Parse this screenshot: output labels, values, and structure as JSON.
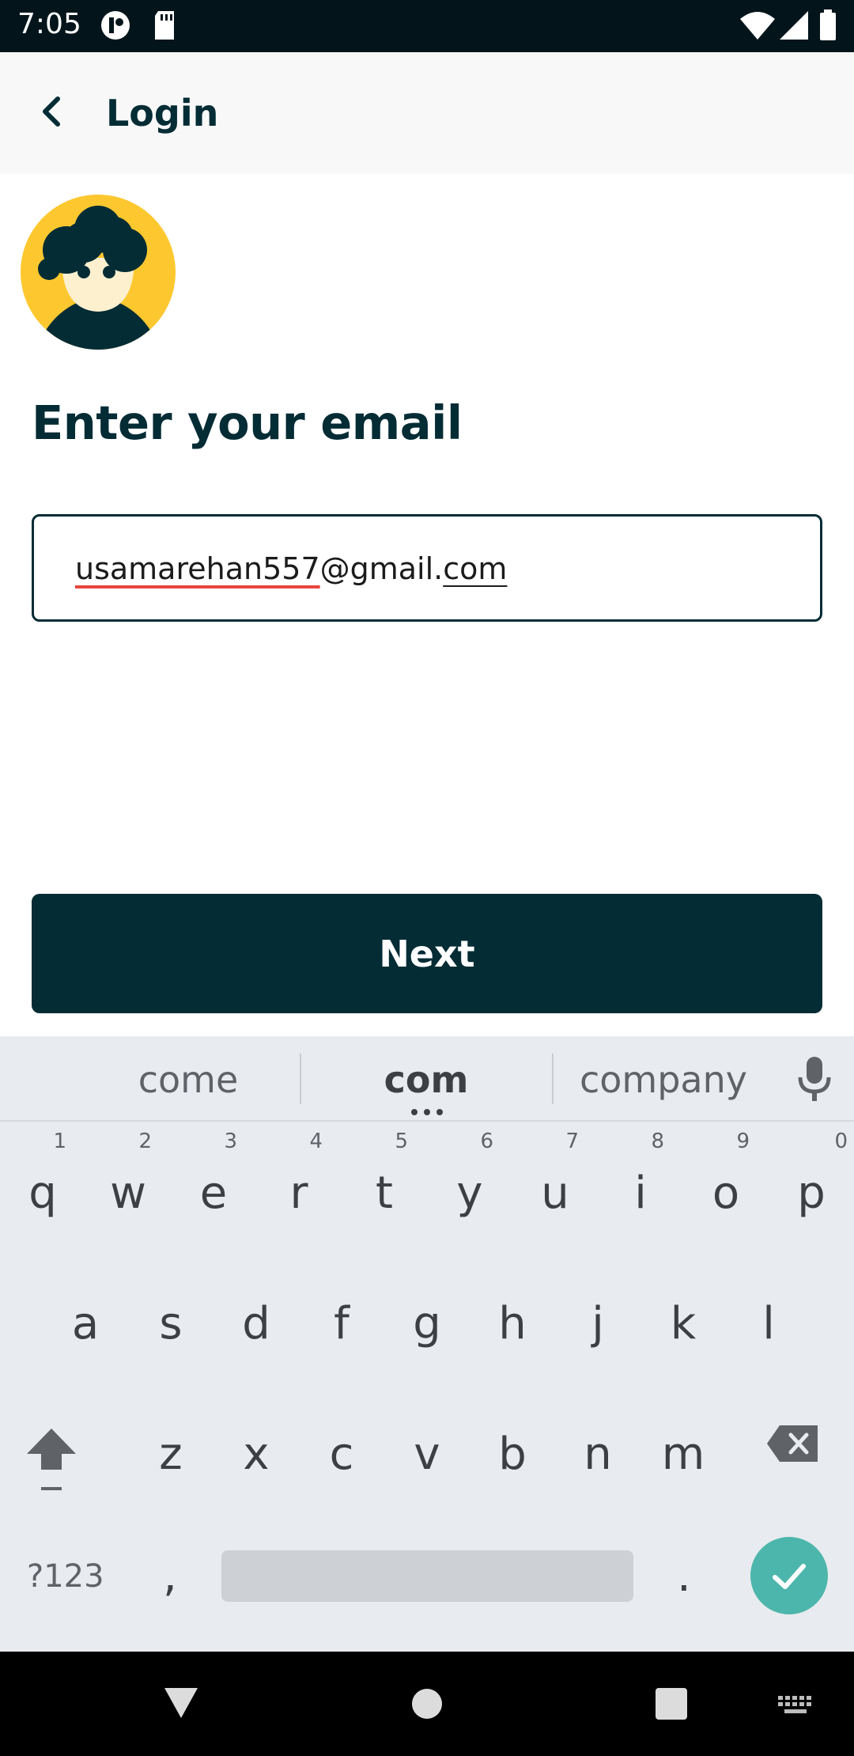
{
  "status_bar": {
    "time": "7:05"
  },
  "app_bar": {
    "title": "Login"
  },
  "page": {
    "heading": "Enter your email",
    "email_value_part1": "usamarehan557",
    "email_value_part2": "@gmail.",
    "email_value_part3": "com",
    "next_label": "Next"
  },
  "keyboard": {
    "suggestions": [
      "come",
      "com",
      "company"
    ],
    "row1": [
      {
        "k": "q",
        "h": "1"
      },
      {
        "k": "w",
        "h": "2"
      },
      {
        "k": "e",
        "h": "3"
      },
      {
        "k": "r",
        "h": "4"
      },
      {
        "k": "t",
        "h": "5"
      },
      {
        "k": "y",
        "h": "6"
      },
      {
        "k": "u",
        "h": "7"
      },
      {
        "k": "i",
        "h": "8"
      },
      {
        "k": "o",
        "h": "9"
      },
      {
        "k": "p",
        "h": "0"
      }
    ],
    "row2": [
      "a",
      "s",
      "d",
      "f",
      "g",
      "h",
      "j",
      "k",
      "l"
    ],
    "row3": [
      "z",
      "x",
      "c",
      "v",
      "b",
      "n",
      "m"
    ],
    "symbols_label": "?123",
    "comma": ",",
    "period": "."
  },
  "colors": {
    "brand_dark": "#032c35",
    "avatar_yellow": "#fdc82f",
    "accent_teal": "#4db6ac"
  }
}
